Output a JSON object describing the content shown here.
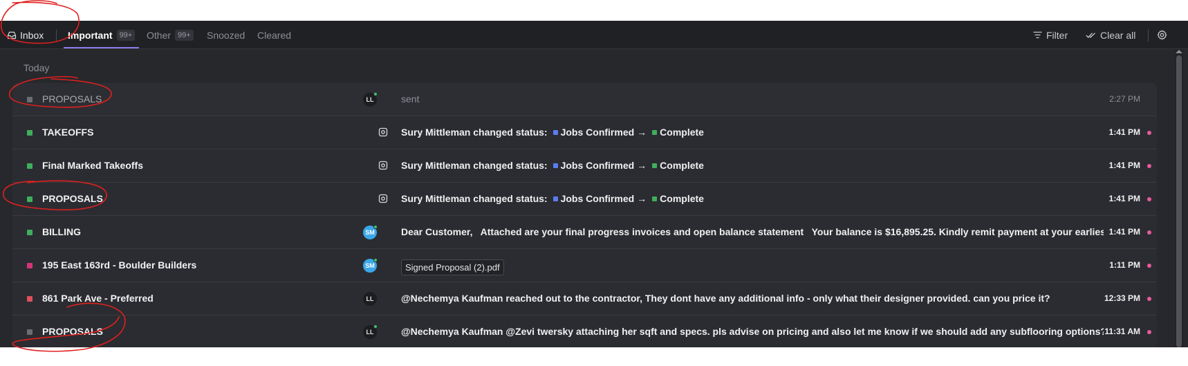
{
  "tabs": {
    "inbox": "Inbox",
    "important": {
      "label": "Important",
      "count": "99+"
    },
    "other": {
      "label": "Other",
      "count": "99+"
    },
    "snoozed": "Snoozed",
    "cleared": "Cleared"
  },
  "toolbar": {
    "filter": "Filter",
    "clear_all": "Clear all"
  },
  "section": "Today",
  "rows": [
    {
      "subject": "PROPOSALS",
      "color": "#6b6d73",
      "avatar": "LL",
      "message": "sent",
      "time": "2:27 PM",
      "read": true
    },
    {
      "subject": "TAKEOFFS",
      "color": "#3fae5b",
      "from": "Sury Mittleman changed status:",
      "status_from": "Jobs Confirmed",
      "status_to": "Complete",
      "time": "1:41 PM"
    },
    {
      "subject": "Final Marked Takeoffs",
      "color": "#3fae5b",
      "from": "Sury Mittleman changed status:",
      "status_from": "Jobs Confirmed",
      "status_to": "Complete",
      "time": "1:41 PM"
    },
    {
      "subject": "PROPOSALS",
      "color": "#3fae5b",
      "from": "Sury Mittleman changed status:",
      "status_from": "Jobs Confirmed",
      "status_to": "Complete",
      "time": "1:41 PM"
    },
    {
      "subject": "BILLING",
      "color": "#3fae5b",
      "avatar": "SM",
      "message": "Dear Customer,   Attached are your final progress invoices and open balance statement   Your balance is $16,895.25. Kindly remit payment at your earliest convenience",
      "time": "1:41 PM"
    },
    {
      "subject": "195 East 163rd - Boulder Builders",
      "color": "#d6337a",
      "avatar": "SM",
      "attachment": "Signed Proposal (2).pdf",
      "time": "1:11 PM"
    },
    {
      "subject": "861 Park Ave - Preferred",
      "color": "#e0505a",
      "avatar": "LL",
      "message": "@Nechemya Kaufman reached out to the contractor, They dont have any additional info - only what their designer provided. can you price it?",
      "time": "12:33 PM"
    },
    {
      "subject": "PROPOSALS",
      "color": "#6b6d73",
      "avatar": "LL",
      "message": "@Nechemya Kaufman @Zevi twersky attaching her sqft and specs. pls advise on pricing and also let me know if we should add any subflooring options? Thank you",
      "time": "11:31 AM"
    }
  ],
  "colors": {
    "status_from": "#5b7cf0",
    "status_to": "#3fae5b",
    "unread_dot": "#e85a9b",
    "accent": "#8b7cf0",
    "annotation": "#e0201f"
  }
}
